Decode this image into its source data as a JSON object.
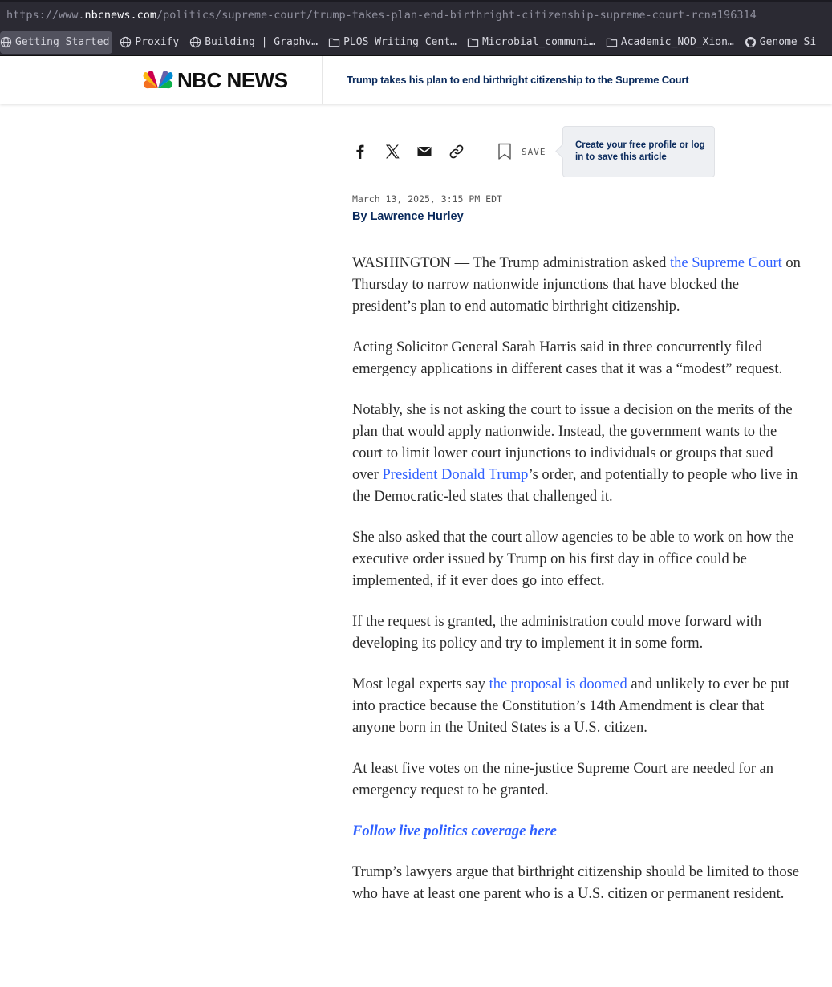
{
  "browser": {
    "url_prefix": "https://www.",
    "url_domain": "nbcnews.com",
    "url_path": "/politics/supreme-court/trump-takes-plan-end-birthright-citizenship-supreme-court-rcna196314",
    "bookmarks": [
      {
        "label": "Getting Started",
        "icon": "globe-icon"
      },
      {
        "label": "Proxify",
        "icon": "globe-icon"
      },
      {
        "label": "Building | Graphv…",
        "icon": "globe-icon"
      },
      {
        "label": "PLOS Writing Cent…",
        "icon": "folder-icon"
      },
      {
        "label": "Microbial_communi…",
        "icon": "folder-icon"
      },
      {
        "label": "Academic_NOD_Xion…",
        "icon": "folder-icon"
      },
      {
        "label": "Genome Si",
        "icon": "github-icon"
      }
    ]
  },
  "header": {
    "logo_text": "NBC NEWS",
    "article_title": "Trump takes his plan to end birthright citizenship to the Supreme Court"
  },
  "share": {
    "save_label": "SAVE",
    "tooltip": "Create your free profile or log in to save this article"
  },
  "meta": {
    "date": "March 13, 2025, 3:15 PM EDT",
    "by": "By",
    "author": "Lawrence Hurley"
  },
  "article": {
    "p1_before": "WASHINGTON — The Trump administration asked ",
    "p1_link": "the Supreme Court",
    "p1_after": " on Thursday to narrow nationwide injunctions that have blocked the president’s plan to end automatic birthright citizenship.",
    "p2": "Acting Solicitor General Sarah Harris said in three concurrently filed emergency applications in different cases that it was a “modest” request.",
    "p3_before": "Notably, she is not asking the court to issue a decision on the merits of the plan that would apply nationwide. Instead, the government wants to the court to limit lower court injunctions to individuals or groups that sued over ",
    "p3_link": "President Donald Trump",
    "p3_after": "’s order, and potentially to people who live in the Democratic-led states that challenged it.",
    "p4": "She also asked that the court allow agencies to be able to work on how the executive order issued by Trump on his first day in office could be implemented, if it ever does go into effect.",
    "p5": "If the request is granted, the administration could move forward with developing its policy and try to implement it in some form.",
    "p6_before": "Most legal experts say ",
    "p6_link": "the proposal is doomed",
    "p6_after": " and unlikely to ever be put into practice because the Constitution’s 14th Amendment is clear that anyone born in the United States is a U.S. citizen.",
    "p7": "At least five votes on the nine-justice Supreme Court are needed for an emergency request to be granted.",
    "follow_link": "Follow live politics coverage here",
    "p8": "Trump’s lawyers argue that birthright citizenship should be limited to those who have at least one parent who is a U.S. citizen or permanent resident."
  },
  "colors": {
    "link": "#3061ff",
    "navy": "#0a2a5c",
    "browser_chrome": "#2b2a33"
  }
}
